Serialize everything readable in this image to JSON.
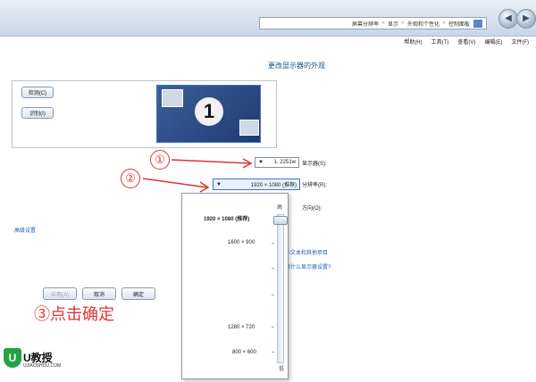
{
  "window": {
    "breadcrumb": [
      "屏幕分辨率",
      "显示",
      "外观和个性化",
      "控制面板"
    ],
    "menu": [
      "文件(F)",
      "编辑(E)",
      "查看(V)",
      "工具(T)",
      "帮助(H)"
    ]
  },
  "main": {
    "title": "更改显示器的外观",
    "detect_label": "检测(C)",
    "identify_label": "识别(I)",
    "monitor_number": "1",
    "display_label": "显示器(S):",
    "display_value": "1. 2251w",
    "resolution_label": "分辨率(R):",
    "resolution_value": "1920 × 1080 (推荐)",
    "orientation_label": "方向(O):",
    "advanced_link": "高级设置",
    "link_text_size": "放大或缩小文本和其他项目",
    "link_which_settings": "我应该选择什么显示器设置?"
  },
  "dropdown": {
    "high": "高",
    "low": "低",
    "options": [
      "1920 × 1080 (推荐)",
      "1600 × 900",
      "1280 × 720",
      "800 × 600"
    ],
    "selected": "1920 × 1080 (推荐)",
    "slider_level": 1.0
  },
  "buttons": {
    "ok": "确定",
    "cancel": "取消",
    "apply": "应用(A)"
  },
  "annotations": {
    "step1": "①",
    "step2": "②",
    "step3": "③点击确定",
    "color": "#e03434"
  },
  "logo": {
    "text": "U教授",
    "domain": "UJIAOSHOU.COM",
    "shield_letter": "U",
    "color": "#25a244"
  }
}
